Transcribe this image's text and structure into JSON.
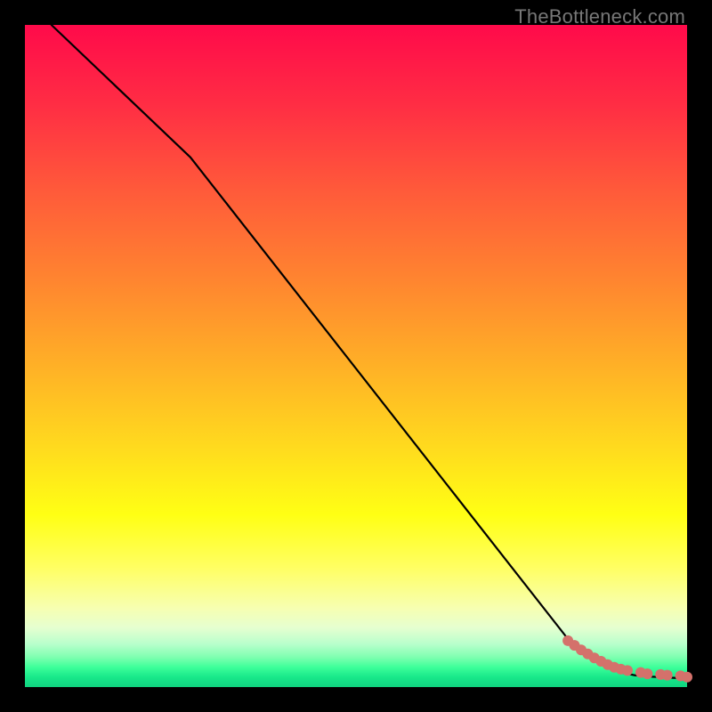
{
  "watermark": "TheBottleneck.com",
  "chart_data": {
    "type": "line",
    "title": "",
    "xlabel": "",
    "ylabel": "",
    "xlim": [
      0,
      100
    ],
    "ylim": [
      0,
      100
    ],
    "series": [
      {
        "name": "curve",
        "style": "line-black",
        "x": [
          4,
          25,
          83,
          88,
          90,
          92,
          94,
          96,
          98,
          100
        ],
        "y": [
          100,
          80,
          6,
          3,
          2.2,
          1.8,
          1.6,
          1.5,
          1.4,
          1.3
        ]
      },
      {
        "name": "points-cluster",
        "style": "points-salmon",
        "x": [
          82,
          83,
          84,
          85,
          86,
          87,
          88,
          89,
          90,
          91,
          93,
          94,
          96,
          97,
          99,
          100
        ],
        "y": [
          7.0,
          6.3,
          5.6,
          5.0,
          4.4,
          3.9,
          3.4,
          3.0,
          2.7,
          2.5,
          2.2,
          2.0,
          1.9,
          1.8,
          1.7,
          1.5
        ]
      }
    ],
    "colors": {
      "curve": "#000000",
      "points": "#d4716b"
    }
  }
}
